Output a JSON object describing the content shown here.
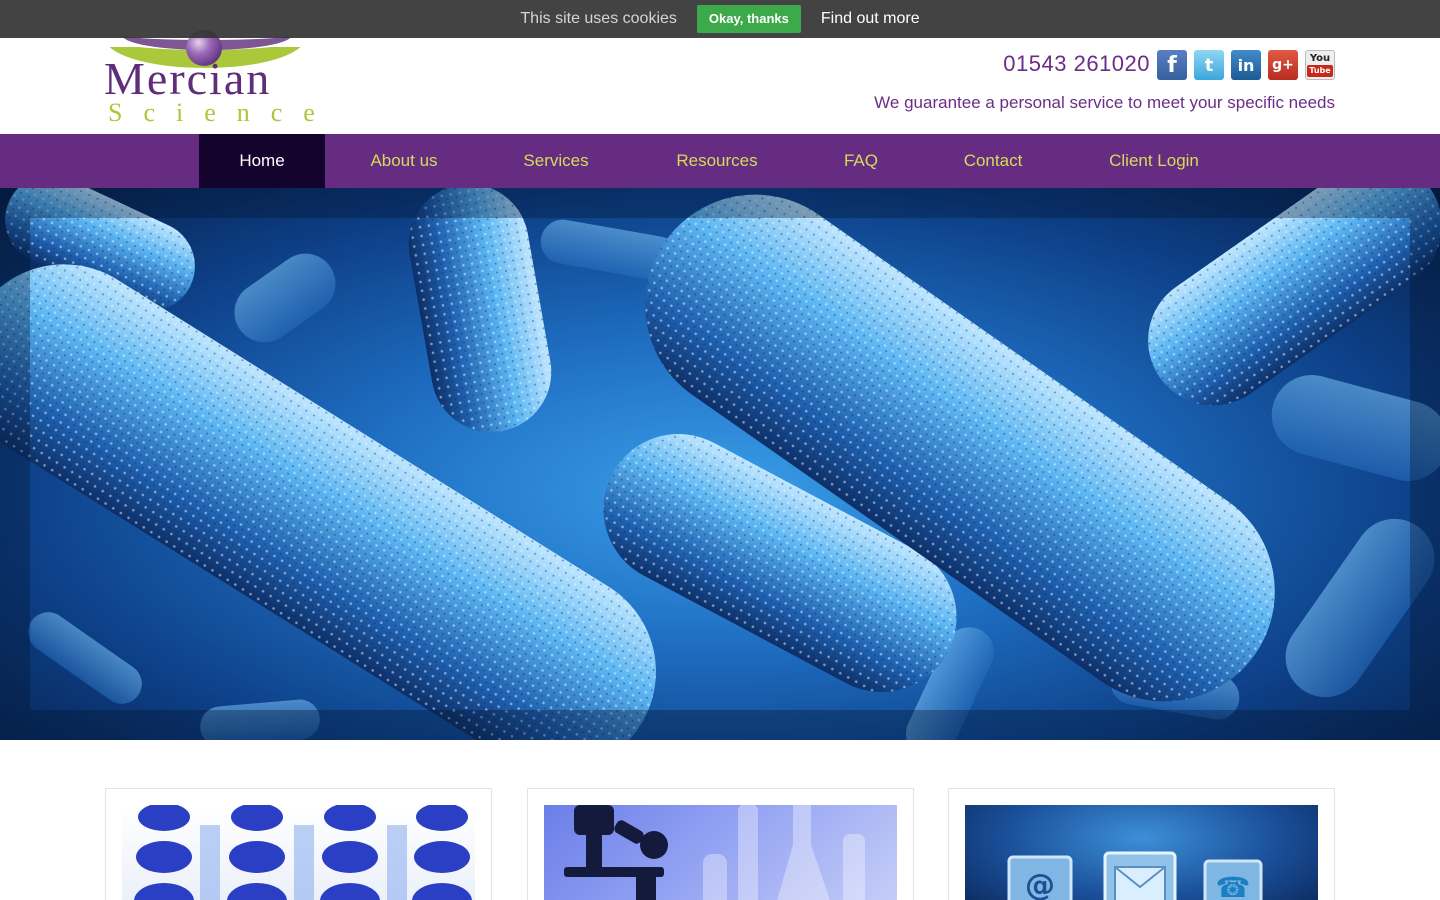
{
  "cookie_bar": {
    "message": "This site uses cookies",
    "accept_label": "Okay, thanks",
    "more_label": "Find out more"
  },
  "header": {
    "logo_main": "Mercian",
    "logo_sub": "Science",
    "phone": "01543 261020",
    "tagline": "We guarantee a personal service to meet your specific needs",
    "socials": [
      {
        "name": "facebook-icon",
        "glyph": "f"
      },
      {
        "name": "twitter-icon",
        "glyph": "t"
      },
      {
        "name": "linkedin-icon",
        "glyph": "in"
      },
      {
        "name": "google-plus-icon",
        "glyph": "g+"
      },
      {
        "name": "youtube-icon",
        "glyph_top": "You",
        "glyph_bottom": "Tube"
      }
    ]
  },
  "nav": {
    "items": [
      {
        "label": "Home",
        "active": true
      },
      {
        "label": "About us"
      },
      {
        "label": "Services"
      },
      {
        "label": "Resources"
      },
      {
        "label": "FAQ"
      },
      {
        "label": "Contact"
      },
      {
        "label": "Client Login"
      }
    ]
  },
  "colors": {
    "brand_purple": "#662c82",
    "nav_active": "#14042d",
    "nav_text": "#d3dc5a",
    "brand_green": "#a9c93a",
    "cookie_accept": "#3ca94b"
  }
}
